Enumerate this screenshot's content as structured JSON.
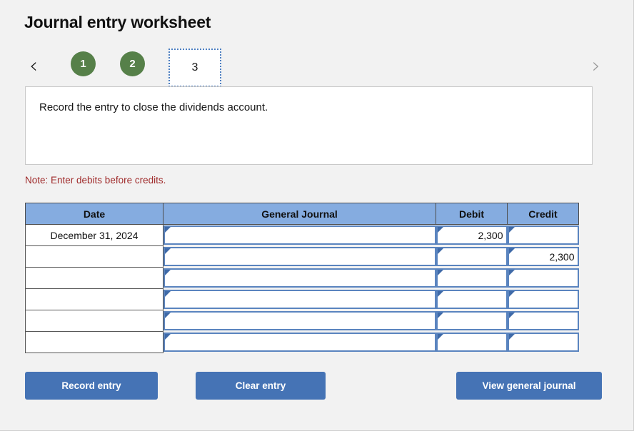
{
  "page_title": "Journal entry worksheet",
  "pager": {
    "prev_icon": "chevron-left-icon",
    "prev_label": "‹",
    "next_icon": "chevron-right-icon",
    "next_label": "›",
    "steps": [
      {
        "label": "1",
        "state": "completed"
      },
      {
        "label": "2",
        "state": "completed"
      },
      {
        "label": "3",
        "state": "current"
      }
    ]
  },
  "instruction": {
    "text": "Record the entry to close the dividends account."
  },
  "note": "Note: Enter debits before credits.",
  "table": {
    "headers": [
      "Date",
      "General Journal",
      "Debit",
      "Credit"
    ],
    "rows": [
      {
        "date": "December 31, 2024",
        "general_journal": "",
        "debit": "2,300",
        "credit": ""
      },
      {
        "date": "",
        "general_journal": "",
        "debit": "",
        "credit": "2,300"
      },
      {
        "date": "",
        "general_journal": "",
        "debit": "",
        "credit": ""
      },
      {
        "date": "",
        "general_journal": "",
        "debit": "",
        "credit": ""
      },
      {
        "date": "",
        "general_journal": "",
        "debit": "",
        "credit": ""
      },
      {
        "date": "",
        "general_journal": "",
        "debit": "",
        "credit": ""
      }
    ]
  },
  "buttons": {
    "record": "Record entry",
    "clear": "Clear entry",
    "view": "View general journal"
  },
  "colors": {
    "step_completed": "#568049",
    "step_current_border": "#4c7ec0",
    "table_header": "#85ace0",
    "button": "#4573b5",
    "note": "#a02c2c",
    "field_border": "#5a84bf",
    "page_background": "#f2f2f2"
  }
}
